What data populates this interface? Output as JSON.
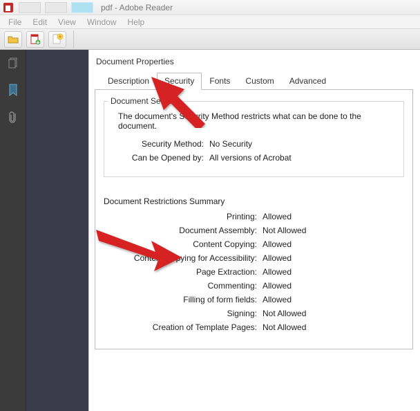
{
  "titlebar": {
    "title": "pdf - Adobe Reader"
  },
  "menu": {
    "file": "File",
    "edit": "Edit",
    "view": "View",
    "window": "Window",
    "help": "Help"
  },
  "dialog": {
    "title": "Document Properties",
    "tabs": {
      "description": "Description",
      "security": "Security",
      "fonts": "Fonts",
      "custom": "Custom",
      "advanced": "Advanced"
    },
    "doc_security": {
      "group_label": "Document Security",
      "description": "The document's Security Method restricts what can be done to the document.",
      "method_label": "Security Method:",
      "method_value": "No Security",
      "opened_by_label": "Can be Opened by:",
      "opened_by_value": "All versions of Acrobat"
    },
    "restrictions": {
      "title": "Document Restrictions Summary",
      "items": [
        {
          "label": "Printing:",
          "value": "Allowed"
        },
        {
          "label": "Document Assembly:",
          "value": "Not Allowed"
        },
        {
          "label": "Content Copying:",
          "value": "Allowed"
        },
        {
          "label": "Content Copying for Accessibility:",
          "value": "Allowed"
        },
        {
          "label": "Page Extraction:",
          "value": "Allowed"
        },
        {
          "label": "Commenting:",
          "value": "Allowed"
        },
        {
          "label": "Filling of form fields:",
          "value": "Allowed"
        },
        {
          "label": "Signing:",
          "value": "Not Allowed"
        },
        {
          "label": "Creation of Template Pages:",
          "value": "Not Allowed"
        }
      ]
    }
  },
  "colors": {
    "arrow": "#d62323"
  }
}
